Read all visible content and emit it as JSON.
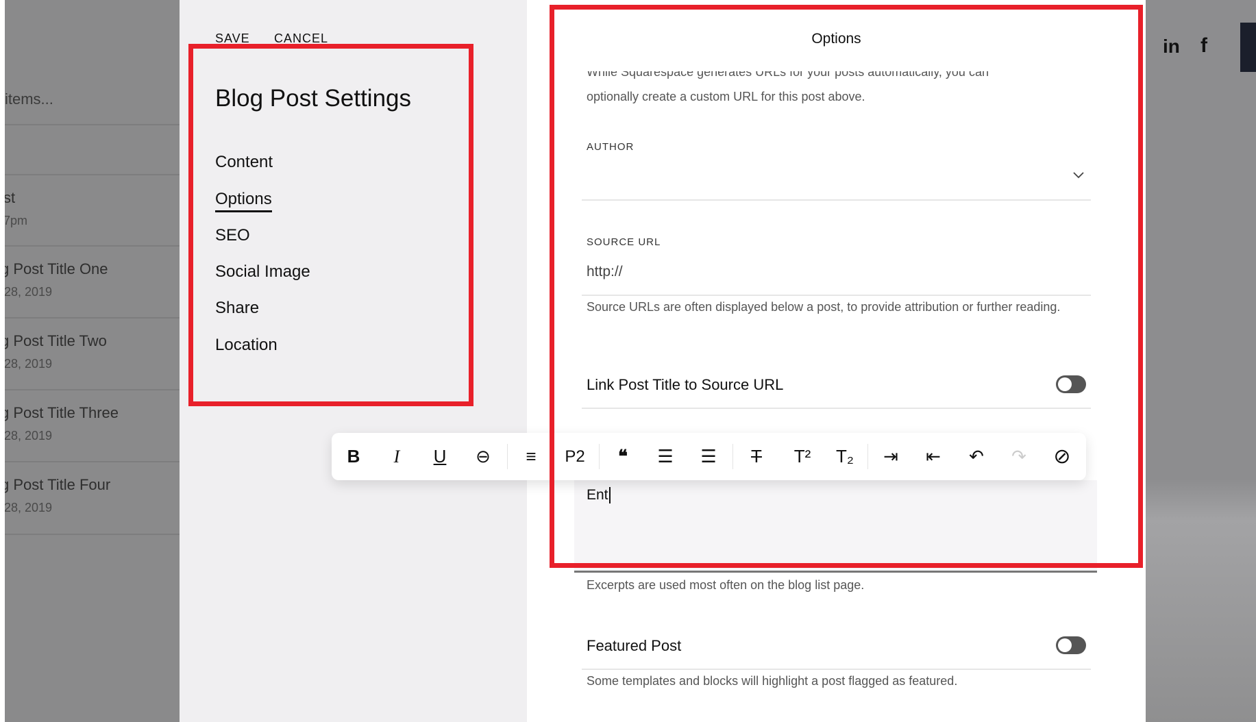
{
  "background_list": {
    "search_text": "items...",
    "items": [
      {
        "title": "st",
        "date": "7pm"
      },
      {
        "title": "g Post Title One",
        "date": "28, 2019"
      },
      {
        "title": "g Post Title Two",
        "date": "28, 2019"
      },
      {
        "title": "g Post Title Three",
        "date": "28, 2019"
      },
      {
        "title": "g Post Title Four",
        "date": "28, 2019"
      }
    ]
  },
  "settings": {
    "save_label": "SAVE",
    "cancel_label": "CANCEL",
    "title": "Blog Post Settings",
    "nav": [
      {
        "label": "Content"
      },
      {
        "label": "Options",
        "active": true
      },
      {
        "label": "SEO"
      },
      {
        "label": "Social Image"
      },
      {
        "label": "Share"
      },
      {
        "label": "Location"
      }
    ]
  },
  "options": {
    "title": "Options",
    "url_help_clipped": "While Squarespace generates URLs for your posts automatically, you can",
    "url_help": "optionally create a custom URL for this post above.",
    "author_label": "AUTHOR",
    "author_value": "",
    "source_url_label": "SOURCE URL",
    "source_url_value": "http://",
    "source_url_help": "Source URLs are often displayed below a post, to provide attribution or further reading.",
    "link_title_label": "Link Post Title to Source URL",
    "link_title_on": false,
    "excerpt_value": "Ent",
    "excerpt_help": "Excerpts are used most often on the blog list page.",
    "featured_label": "Featured Post",
    "featured_on": false,
    "featured_help": "Some templates and blocks will highlight a post flagged as featured."
  },
  "toolbar": {
    "bold": "B",
    "italic": "I",
    "underline": "U",
    "link": "⊖",
    "align": "≡",
    "paragraph": "P2",
    "quote": "❝",
    "ordered_list": "☰",
    "bullet_list": "☰",
    "strikethrough": "T",
    "superscript": "T²",
    "subscript": "T₂",
    "indent": "⇥",
    "outdent": "⇤",
    "undo": "↶",
    "redo": "↷",
    "clear": "⊘"
  },
  "social": {
    "linkedin": "in",
    "facebook": "f"
  },
  "colors": {
    "highlight_box": "#e8202a",
    "toggle_off": "#555555"
  }
}
